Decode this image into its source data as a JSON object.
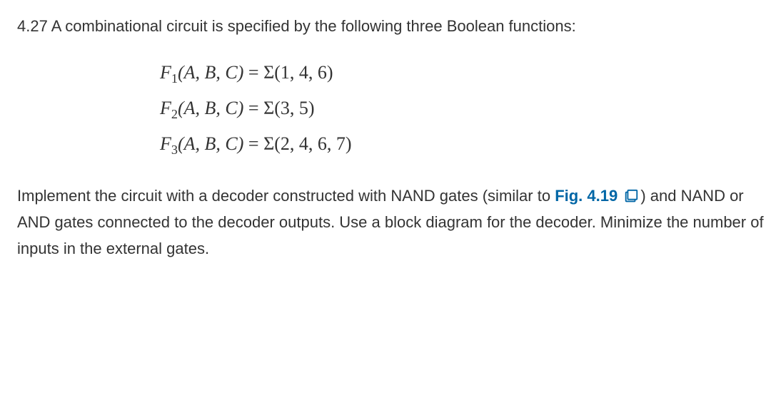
{
  "problem": {
    "number": "4.27",
    "intro": "A combinational circuit is specified by the following three Boolean functions:"
  },
  "equations": {
    "f1": {
      "name": "F",
      "sub": "1",
      "args": "(A,  B,  C)",
      "eq": " = ",
      "sigma": "Σ",
      "minterms": "(1,  4,  6)"
    },
    "f2": {
      "name": "F",
      "sub": "2",
      "args": "(A,  B,  C)",
      "eq": " = ",
      "sigma": "Σ",
      "minterms": "(3,  5)"
    },
    "f3": {
      "name": "F",
      "sub": "3",
      "args": "(A,  B,  C)",
      "eq": " = ",
      "sigma": "Σ",
      "minterms": "(2,  4,  6,  7)"
    }
  },
  "instruction": {
    "part1": "Implement the circuit with a decoder constructed with NAND gates (similar to ",
    "fig_label": "Fig. 4.19",
    "part2": ") and NAND or AND gates connected to the decoder outputs. Use a block diagram for the decoder. Minimize the number of inputs in the external gates."
  },
  "icons": {
    "book": "book-icon"
  }
}
